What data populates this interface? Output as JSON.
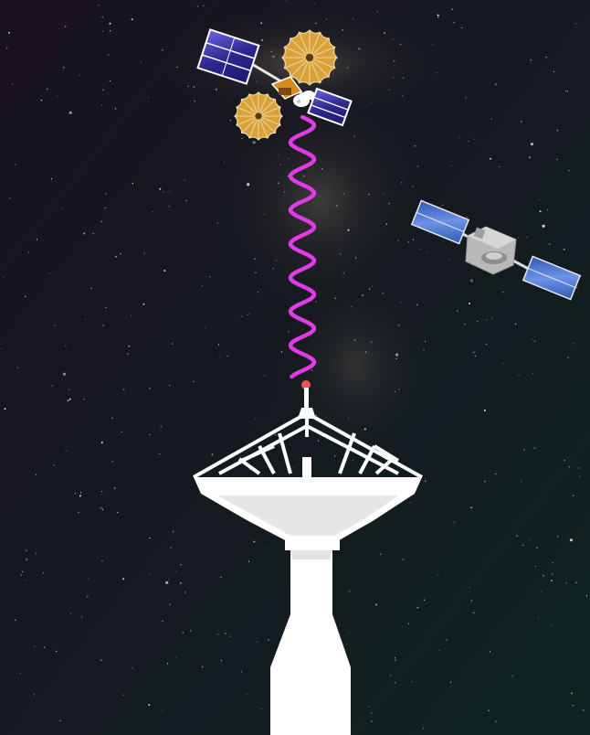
{
  "scene": {
    "description_free": true,
    "colors": {
      "space_top": "#17121f",
      "space_bottom": "#0f2220",
      "milky_way": "#7a6a5a",
      "signal_wave": "#e23ce6",
      "signal_tip": "#e05a55",
      "antenna_white": "#ffffff",
      "antenna_shadow": "#d9d9d9",
      "solar_panel": "#2d2a8c",
      "solar_panel_light": "#5a56d6",
      "reflector_gold": "#d9a23a",
      "satellite_body": "#d98a1a",
      "satellite2_panel": "#3a66c9",
      "satellite2_body": "#b9b9b9"
    },
    "objects": [
      {
        "name": "relay-satellite",
        "icon": "satellite-with-dish-reflectors-icon"
      },
      {
        "name": "orbiter-satellite",
        "icon": "satellite-with-solar-panels-icon"
      },
      {
        "name": "ground-station-antenna",
        "icon": "radio-dish-tower-icon"
      },
      {
        "name": "signal-wave",
        "icon": "wavy-signal-icon"
      }
    ]
  }
}
